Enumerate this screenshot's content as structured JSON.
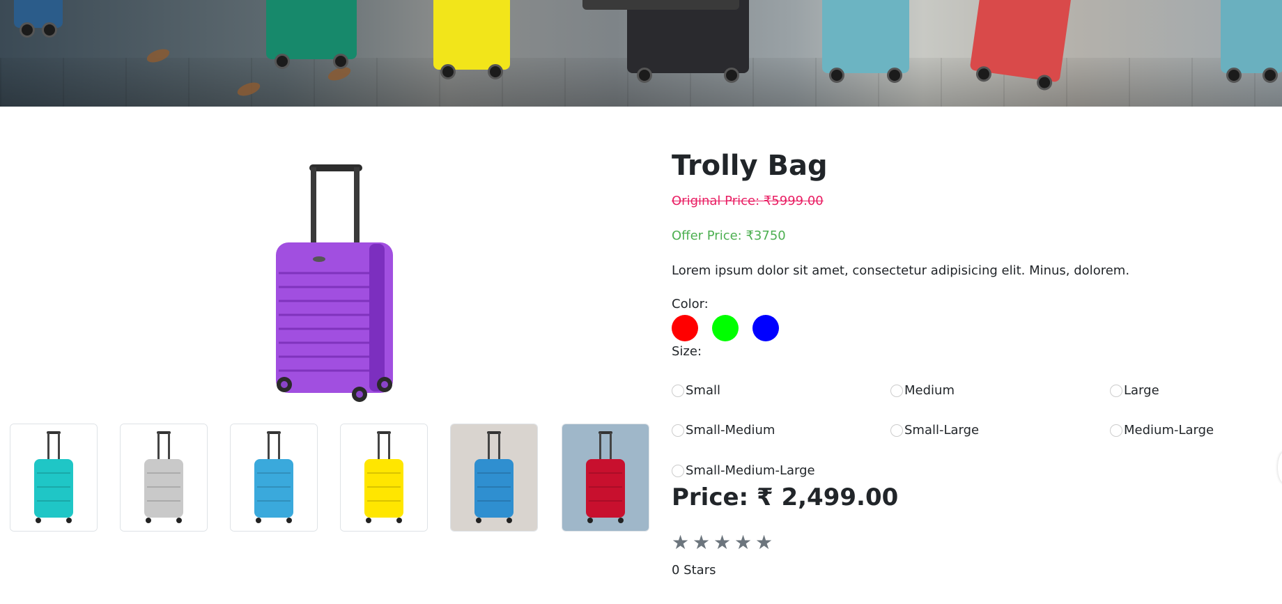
{
  "banner": {
    "icon": "luggage-banner-image"
  },
  "product": {
    "title": "Trolly Bag",
    "original_price": "Original Price: ₹5999.00",
    "offer_price": "Offer Price: ₹3750",
    "description": "Lorem ipsum dolor sit amet, consectetur adipisicing elit. Minus, dolorem.",
    "color_label": "Color:",
    "colors": [
      "#ff0000",
      "#00ff00",
      "#0000ff"
    ],
    "size_label": "Size:",
    "sizes": [
      "Small",
      "Medium",
      "Large",
      "Small-Medium",
      "Small-Large",
      "Medium-Large",
      "Small-Medium-Large"
    ],
    "price": "Price: ₹ 2,499.00",
    "stars": [
      "★",
      "★",
      "★",
      "★",
      "★"
    ],
    "stars_text": "0 Stars",
    "rating": 0
  },
  "gallery": {
    "main_color": "#a14fe0",
    "thumbnails": [
      {
        "icon": "teal-suitcase-thumbnail",
        "color": "#1fc6c6"
      },
      {
        "icon": "silver-suitcase-thumbnail",
        "color": "#c9c9c9"
      },
      {
        "icon": "blue-suitcase-thumbnail",
        "color": "#3aa9dc"
      },
      {
        "icon": "yellow-suitcase-thumbnail",
        "color": "#ffe600"
      },
      {
        "icon": "blue-suitcase-person-thumbnail",
        "color": "#2f8fd0"
      },
      {
        "icon": "red-suitcase-thumbnail",
        "color": "#c8102e"
      }
    ]
  }
}
